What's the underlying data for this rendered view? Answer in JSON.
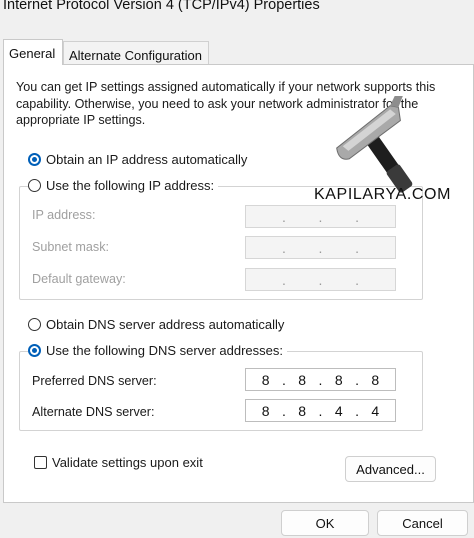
{
  "window": {
    "title": "Internet Protocol Version 4 (TCP/IPv4) Properties"
  },
  "tabs": [
    {
      "label": "General",
      "active": true
    },
    {
      "label": "Alternate Configuration",
      "active": false
    }
  ],
  "intro_text": "You can get IP settings assigned automatically if your network supports this capability. Otherwise, you need to ask your network administrator for the appropriate IP settings.",
  "ip_section": {
    "auto_label": "Obtain an IP address automatically",
    "auto_selected": true,
    "manual_label": "Use the following IP address:",
    "manual_selected": false,
    "fields": [
      {
        "label": "IP address:",
        "value": ". . ."
      },
      {
        "label": "Subnet mask:",
        "value": ". . ."
      },
      {
        "label": "Default gateway:",
        "value": ". . ."
      }
    ]
  },
  "dns_section": {
    "auto_label": "Obtain DNS server address automatically",
    "auto_selected": false,
    "manual_label": "Use the following DNS server addresses:",
    "manual_selected": true,
    "preferred": {
      "label": "Preferred DNS server:",
      "octets": [
        "8",
        "8",
        "8",
        "8"
      ]
    },
    "alternate": {
      "label": "Alternate DNS server:",
      "octets": [
        "8",
        "8",
        "4",
        "4"
      ]
    }
  },
  "validate": {
    "label": "Validate settings upon exit",
    "checked": false
  },
  "buttons": {
    "advanced": "Advanced...",
    "ok": "OK",
    "cancel": "Cancel"
  },
  "watermark": {
    "text": "KAPILARYA.COM",
    "icon": "hammer-icon"
  },
  "colors": {
    "accent": "#005fb8",
    "background": "#f0f0f0",
    "panel": "#ffffff",
    "disabled_text": "#a0a0a0"
  }
}
